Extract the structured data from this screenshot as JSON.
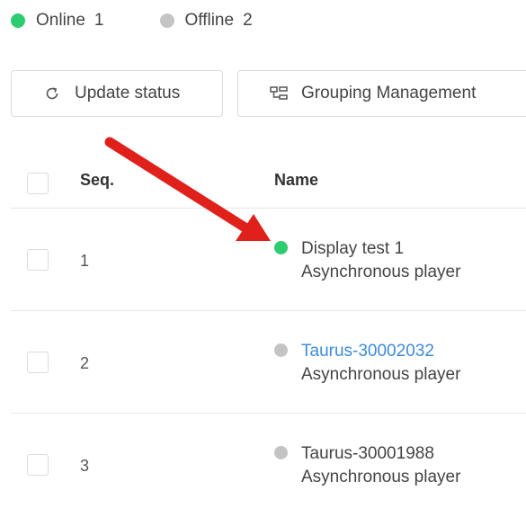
{
  "legend": {
    "online_label": "Online",
    "online_count": "1",
    "offline_label": "Offline",
    "offline_count": "2"
  },
  "toolbar": {
    "update_label": "Update status",
    "grouping_label": "Grouping Management"
  },
  "table": {
    "headers": {
      "seq": "Seq.",
      "name": "Name"
    },
    "rows": [
      {
        "seq": "1",
        "name": "Display test 1",
        "type": "Asynchronous player",
        "status": "online"
      },
      {
        "seq": "2",
        "name": "Taurus-30002032",
        "type": "Asynchronous player",
        "status": "offline"
      },
      {
        "seq": "3",
        "name": "Taurus-30001988",
        "type": "Asynchronous player",
        "status": "offline"
      }
    ]
  },
  "colors": {
    "online": "#2ecc71",
    "offline": "#c4c4c4",
    "link": "#3d8bd8",
    "annotation_arrow": "#e0201b"
  }
}
